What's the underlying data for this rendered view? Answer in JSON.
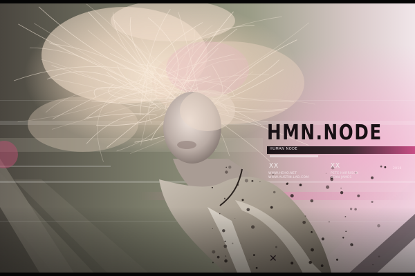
{
  "artwork": {
    "title": "HMN.NODE",
    "bar_label": "HUMAN NODE",
    "marks": {
      "left": "XX",
      "right": "XX"
    },
    "info_left": [
      "WWW.HEHO.NET",
      "WWW.AUSTIN.LAB.COM"
    ],
    "info_right": [
      "PETE HARRISON",
      "SEAN JAMES"
    ],
    "info_far": "2010",
    "colors": {
      "accent_pink": "#c94f86",
      "sage": "#8f957c",
      "hair": "#f1dcc2",
      "dark": "#181014"
    },
    "subject": "woman with windswept blonde hair"
  }
}
